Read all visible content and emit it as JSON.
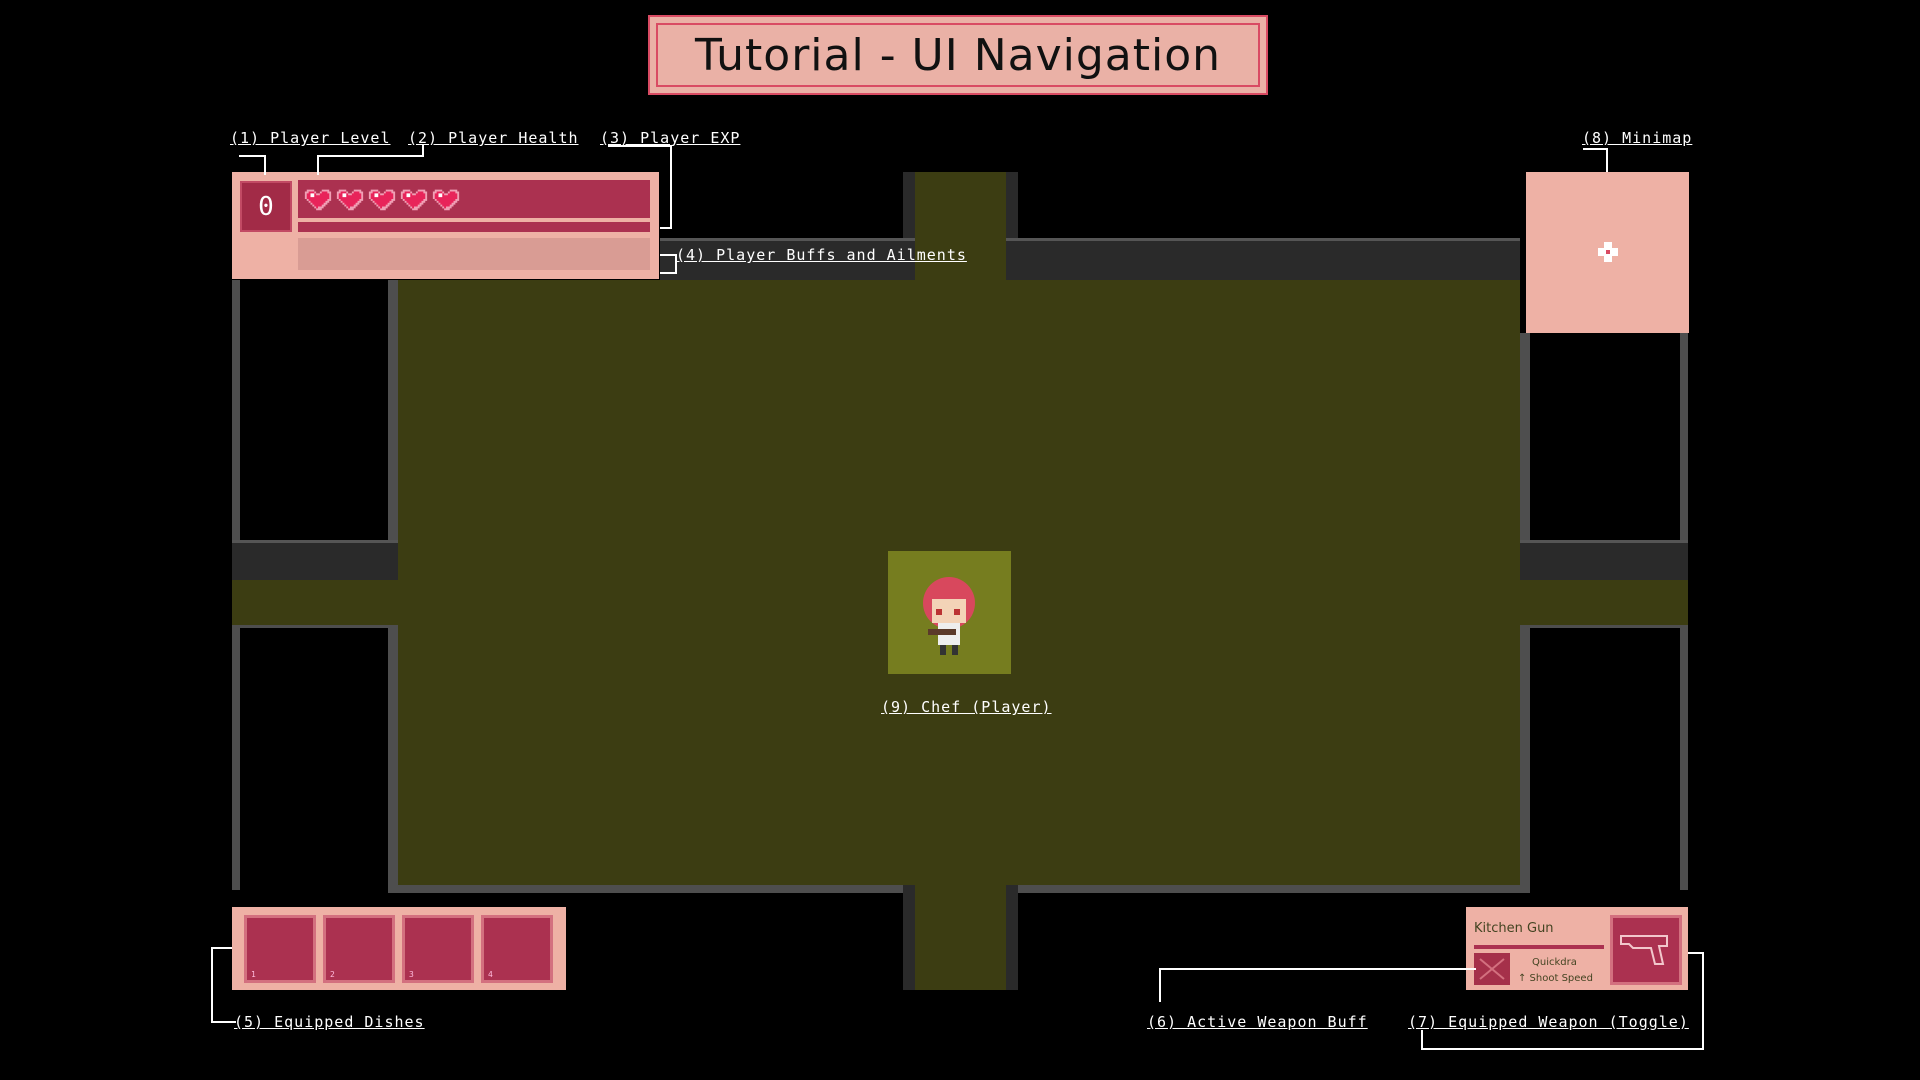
{
  "title": "Tutorial - UI Navigation",
  "labels": {
    "player_level": "(1) Player Level",
    "player_health": "(2) Player Health",
    "player_exp": "(3) Player EXP",
    "player_buffs": "(4) Player Buffs and Ailments",
    "equipped_dishes": "(5) Equipped Dishes",
    "active_weapon_buff": "(6) Active Weapon Buff",
    "equipped_weapon": "(7) Equipped Weapon (Toggle)",
    "minimap": "(8) Minimap",
    "chef_player": "(9) Chef (Player)"
  },
  "hud": {
    "level": "0",
    "hearts": 5,
    "dish_slots": [
      "1",
      "2",
      "3",
      "4"
    ]
  },
  "weapon": {
    "name": "Kitchen Gun",
    "buff_name": "Quickdra",
    "buff_desc": "↑ Shoot Speed"
  },
  "colors": {
    "panel": "#eeb1a5",
    "slot": "#ab3150",
    "floor": "#3c3d12",
    "heart": "#e8245a"
  }
}
